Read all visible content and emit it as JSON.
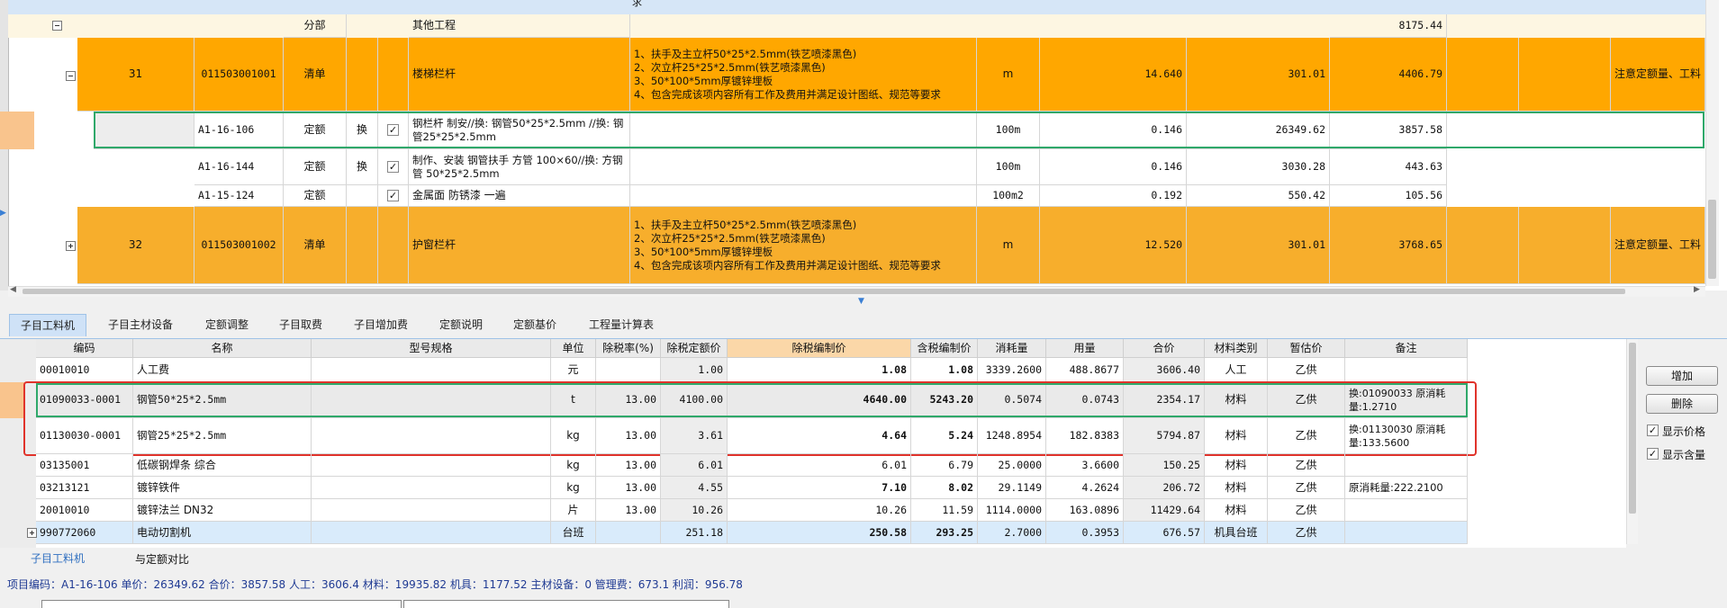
{
  "upper": {
    "rows": [
      {
        "kind": "section",
        "type": "分部",
        "name": "其他工程",
        "total": "8175.44"
      },
      {
        "kind": "bill",
        "seq": "31",
        "code": "011503001001",
        "type": "清单",
        "name": "楼梯栏杆",
        "feature": "1、扶手及主立杆50*25*2.5mm(铁艺喷漆黑色)\n2、次立杆25*25*2.5mm(铁艺喷漆黑色)\n3、50*100*5mm厚镀锌埋板\n4、包含完成该项内容所有工作及费用并满足设计图纸、规范等要求",
        "unit": "m",
        "qty": "14.640",
        "price": "301.01",
        "total": "4406.79",
        "remark": "注意定额量、工料"
      },
      {
        "kind": "quota",
        "code": "A1-16-106",
        "type": "定额",
        "swap": "换",
        "name": "钢栏杆 制安//换: 钢管50*25*2.5mm //换: 钢管25*25*2.5mm",
        "unit": "100m",
        "qty": "0.146",
        "price": "26349.62",
        "total": "3857.58"
      },
      {
        "kind": "quota",
        "code": "A1-16-144",
        "type": "定额",
        "swap": "换",
        "name": "制作、安装 钢管扶手 方管 100×60//换: 方钢管 50*25*2.5mm",
        "unit": "100m",
        "qty": "0.146",
        "price": "3030.28",
        "total": "443.63"
      },
      {
        "kind": "quota",
        "code": "A1-15-124",
        "type": "定额",
        "swap": "",
        "name": "金属面 防锈漆 一遍",
        "unit": "100m2",
        "qty": "0.192",
        "price": "550.42",
        "total": "105.56"
      },
      {
        "kind": "bill",
        "seq": "32",
        "code": "011503001002",
        "type": "清单",
        "name": "护窗栏杆",
        "feature": "1、扶手及主立杆50*25*2.5mm(铁艺喷漆黑色)\n2、次立杆25*25*2.5mm(铁艺喷漆黑色)\n3、50*100*5mm厚镀锌埋板\n4、包含完成该项内容所有工作及费用并满足设计图纸、规范等要求",
        "unit": "m",
        "qty": "12.520",
        "price": "301.01",
        "total": "3768.65",
        "remark": "注意定额量、工料"
      }
    ],
    "top_cutoff_text": "求"
  },
  "tabs": [
    "子目工料机",
    "子目主材设备",
    "定额调整",
    "子目取费",
    "子目增加费",
    "定额说明",
    "定额基价",
    "工程量计算表"
  ],
  "lower": {
    "headers": [
      "编码",
      "名称",
      "型号规格",
      "单位",
      "除税率(%)",
      "除税定额价",
      "除税编制价",
      "含税编制价",
      "消耗量",
      "用量",
      "合价",
      "材料类别",
      "暂估价",
      "备注"
    ],
    "rows": [
      {
        "code": "00010010",
        "name": "人工费",
        "unit": "元",
        "rate": "",
        "qprice": "1.00",
        "eprice": "1.08",
        "tprice": "1.08",
        "cons": "3339.2600",
        "use": "488.8677",
        "total": "3606.40",
        "cat": "人工",
        "est": "乙供",
        "note": ""
      },
      {
        "code": "01090033-0001",
        "name": "钢管50*25*2.5mm",
        "unit": "t",
        "rate": "13.00",
        "qprice": "4100.00",
        "eprice": "4640.00",
        "tprice": "5243.20",
        "cons": "0.5074",
        "use": "0.0743",
        "total": "2354.17",
        "cat": "材料",
        "est": "乙供",
        "note": "换:01090033 原消耗量:1.2710"
      },
      {
        "code": "01130030-0001",
        "name": "钢管25*25*2.5mm",
        "unit": "kg",
        "rate": "13.00",
        "qprice": "3.61",
        "eprice": "4.64",
        "tprice": "5.24",
        "cons": "1248.8954",
        "use": "182.8383",
        "total": "5794.87",
        "cat": "材料",
        "est": "乙供",
        "note": "换:01130030 原消耗量:133.5600"
      },
      {
        "code": "03135001",
        "name": "低碳钢焊条 综合",
        "unit": "kg",
        "rate": "13.00",
        "qprice": "6.01",
        "eprice": "6.01",
        "tprice": "6.79",
        "cons": "25.0000",
        "use": "3.6600",
        "total": "150.25",
        "cat": "材料",
        "est": "乙供",
        "note": ""
      },
      {
        "code": "03213121",
        "name": "镀锌铁件",
        "unit": "kg",
        "rate": "13.00",
        "qprice": "4.55",
        "eprice": "7.10",
        "tprice": "8.02",
        "cons": "29.1149",
        "use": "4.2624",
        "total": "206.72",
        "cat": "材料",
        "est": "乙供",
        "note": "原消耗量:222.2100"
      },
      {
        "code": "20010010",
        "name": "镀锌法兰 DN32",
        "unit": "片",
        "rate": "13.00",
        "qprice": "10.26",
        "eprice": "10.26",
        "tprice": "11.59",
        "cons": "1114.0000",
        "use": "163.0896",
        "total": "11429.64",
        "cat": "材料",
        "est": "乙供",
        "note": ""
      },
      {
        "code": "990772060",
        "name": "电动切割机",
        "unit": "台班",
        "rate": "",
        "qprice": "251.18",
        "eprice": "250.58",
        "tprice": "293.25",
        "cons": "2.7000",
        "use": "0.3953",
        "total": "676.57",
        "cat": "机具台班",
        "est": "乙供",
        "note": ""
      }
    ]
  },
  "side_panel": {
    "add": "增加",
    "delete": "删除",
    "show_price": "显示价格",
    "show_qty": "显示含量"
  },
  "bottom_tabs": [
    "子目工料机",
    "与定额对比"
  ],
  "status_text": "项目编码：A1-16-106 单价：26349.62 合价：3857.58 人工：3606.4 材料：19935.82 机具：1177.52 主材设备：0 管理费：673.1 利润：956.78",
  "colors": {
    "bill_orange": "#ffa700",
    "highlight_red": "#e0332b",
    "tab_active": "#cfe2f7",
    "status_text": "#1f3a93"
  }
}
